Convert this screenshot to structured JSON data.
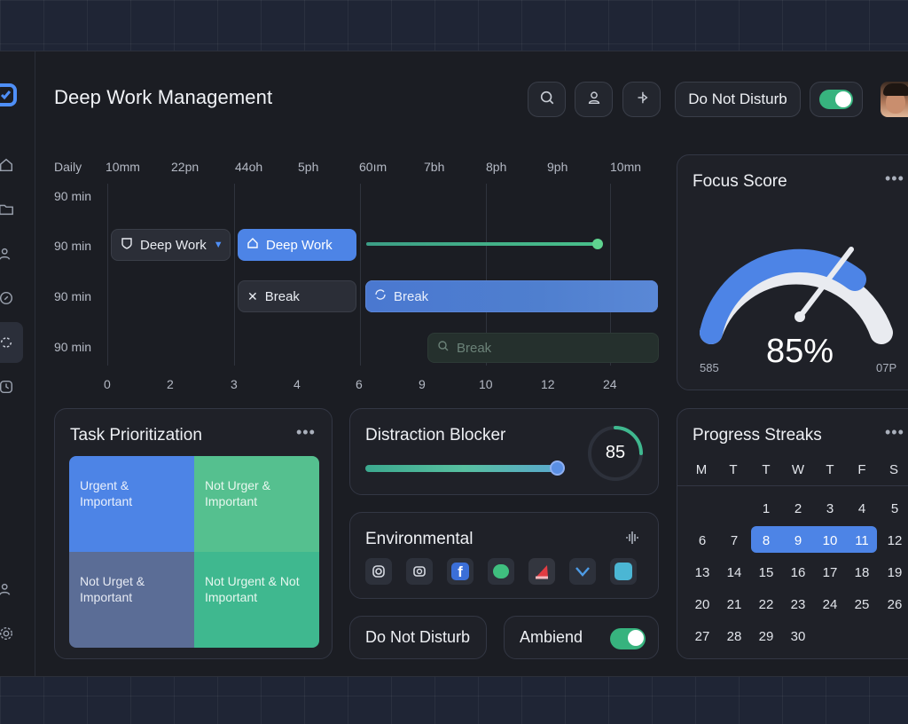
{
  "header": {
    "title": "Deep Work Management",
    "dnd_label": "Do Not Disturb",
    "dnd_enabled": true,
    "icons": [
      "search-icon",
      "user-icon",
      "pin-icon"
    ]
  },
  "sidebar": {
    "icons": [
      "logo-icon",
      "home-icon",
      "folder-icon",
      "users-icon",
      "target-icon",
      "loop-icon",
      "clock-icon",
      "team-icon",
      "settings-icon"
    ],
    "active": "loop-icon"
  },
  "schedule": {
    "header_labels": [
      "Daily",
      "10mm",
      "22pn",
      "44oh",
      "5ph",
      "60ım",
      "7bh",
      "8ph",
      "9ph",
      "10mn"
    ],
    "row_labels": [
      "90 min",
      "90 min",
      "90 min",
      "90 min"
    ],
    "x_ticks": [
      "0",
      "2",
      "3",
      "4",
      "6",
      "9",
      "10",
      "12",
      "24"
    ],
    "blocks": {
      "deep_work_1": "Deep Work",
      "deep_work_2": "Deep Work",
      "break_1": "Break",
      "break_2": "Break",
      "break_3": "Break"
    }
  },
  "focus_score": {
    "title": "Focus Score",
    "value": "85%",
    "fraction": 0.85,
    "left_label": "585",
    "right_label": "07P"
  },
  "tasks": {
    "title": "Task Prioritization",
    "quadrants": [
      "Urgent & Important",
      "Not Urger & Important",
      "Not Urget & Important",
      "Not Urgent & Not Important"
    ]
  },
  "distraction": {
    "title": "Distraction Blocker",
    "value": "85",
    "slider_fraction": 0.95
  },
  "environmental": {
    "title": "Environmental",
    "apps": [
      "instagram-icon",
      "camera-icon",
      "facebook-icon",
      "chat-icon",
      "red-app-icon",
      "chevron-app-icon",
      "store-icon"
    ]
  },
  "bottom": {
    "dnd_label": "Do Not Disturb",
    "ambient_label": "Ambiend",
    "ambient_enabled": true
  },
  "streaks": {
    "title": "Progress Streaks",
    "weekdays": [
      "M",
      "T",
      "T",
      "W",
      "T",
      "F",
      "S"
    ],
    "days": [
      "1",
      "2",
      "3",
      "4",
      "5",
      "6",
      "7",
      "8",
      "9",
      "10",
      "11",
      "12",
      "13",
      "14",
      "15",
      "16",
      "17",
      "18",
      "19",
      "20",
      "21",
      "22",
      "23",
      "24",
      "25",
      "26",
      "27",
      "28",
      "29",
      "30"
    ],
    "highlighted": [
      "8",
      "9",
      "10",
      "11"
    ]
  },
  "colors": {
    "accent_blue": "#4d84e6",
    "accent_green": "#37b37e",
    "bg": "#1b1d23"
  }
}
